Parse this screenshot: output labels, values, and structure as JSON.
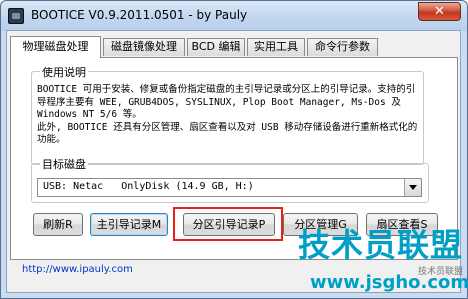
{
  "window": {
    "title": "BOOTICE V0.9.2011.0501 - by Pauly",
    "close_label": "✕"
  },
  "tabs": [
    {
      "label": "物理磁盘处理"
    },
    {
      "label": "磁盘镜像处理"
    },
    {
      "label": "BCD 编辑"
    },
    {
      "label": "实用工具"
    },
    {
      "label": "命令行参数"
    }
  ],
  "usage": {
    "group_label": "使用说明",
    "text": "BOOTICE 可用于安装、修复或备份指定磁盘的主引导记录或分区上的引导记录。支持的引导程序主要有 WEE, GRUB4DOS, SYSLINUX, Plop Boot Manager, Ms-Dos 及 Windows NT 5/6 等。\n此外, BOOTICE 还具有分区管理、扇区查看以及对 USB 移动存储设备进行重新格式化的功能。"
  },
  "target_disk": {
    "group_label": "目标磁盘",
    "selected": "USB: Netac   OnlyDisk (14.9 GB, H:)"
  },
  "buttons": {
    "refresh": "刷新R",
    "mbr": "主引导记录M",
    "pbr": "分区引导记录P",
    "partition": "分区管理G",
    "sector": "扇区查看S"
  },
  "footer": {
    "url": "http://www.ipauly.com"
  },
  "watermark": {
    "main": "技术员联盟",
    "side": "技术员联盟",
    "url": "www.jsgho.com"
  }
}
